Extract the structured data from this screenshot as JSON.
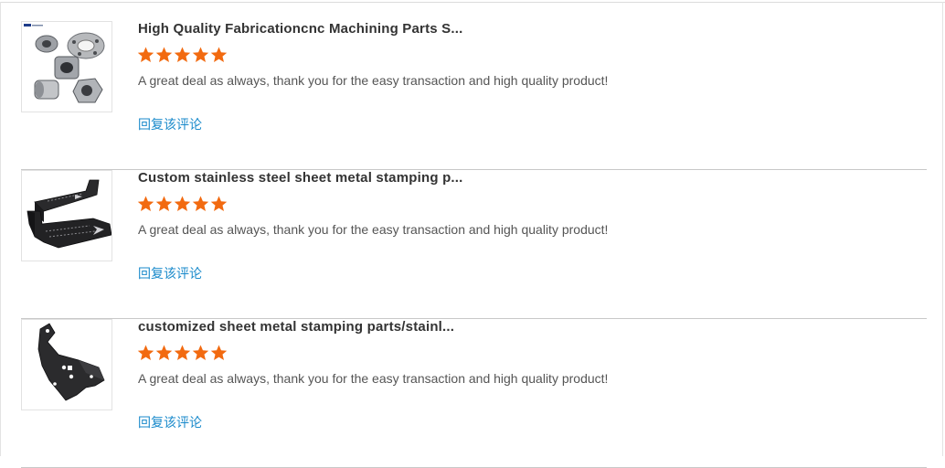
{
  "reviews": [
    {
      "title": "High Quality Fabricationcnc Machining Parts S...",
      "rating": 5,
      "comment": "A great deal as always, thank you for the easy transaction and high quality product!",
      "reply_label": "回复该评论",
      "thumbnail_icon": "cnc-machined-parts-photo"
    },
    {
      "title": "Custom stainless steel sheet metal stamping p...",
      "rating": 5,
      "comment": "A great deal as always, thank you for the easy transaction and high quality product!",
      "reply_label": "回复该评论",
      "thumbnail_icon": "black-stamped-brackets-photo"
    },
    {
      "title": "customized sheet metal stamping parts/stainl...",
      "rating": 5,
      "comment": "A great deal as always, thank you for the easy transaction and high quality product!",
      "reply_label": "回复该评论",
      "thumbnail_icon": "black-bent-bracket-photo"
    }
  ],
  "colors": {
    "star": "#f26a10",
    "reply_link": "#1a8acb",
    "title": "#333333",
    "comment": "#555555"
  }
}
